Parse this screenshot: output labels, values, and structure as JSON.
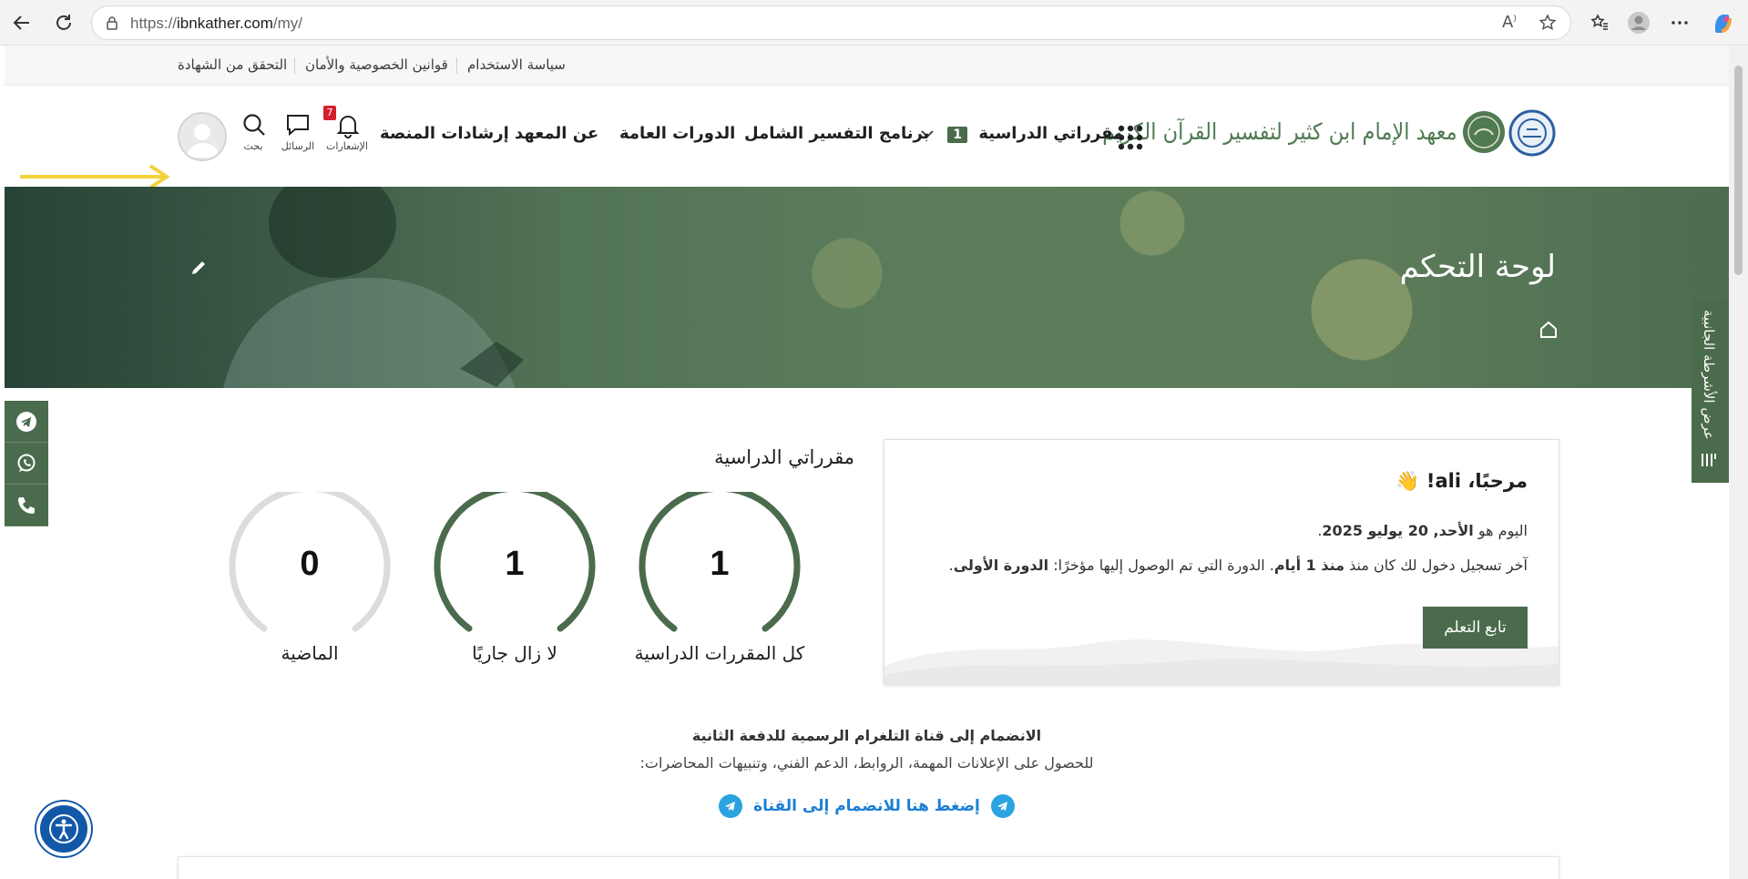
{
  "browser": {
    "url_prefix": "https://",
    "url_domain": "ibnkather.com",
    "url_path": "/my/",
    "read_aloud_label": "A",
    "profile_initial": ""
  },
  "topbar": {
    "links": [
      "سياسة الاستخدام",
      "قوانين الخصوصية والأمان",
      "التحقق من الشهادة"
    ]
  },
  "header": {
    "logo_text": "معهد الإمام ابن كثير لتفسير القرآن الكريم",
    "nav": {
      "my_courses": "مقرراتي الدراسية",
      "my_courses_count": "1",
      "tafsir_program": "برنامج التفسير الشامل",
      "general_courses": "الدورات العامة",
      "about": "عن المعهد",
      "guidance": "إرشادات المنصة"
    },
    "icons": {
      "notifications_label": "الإشعارات",
      "notifications_count": "7",
      "messages_label": "الرسائل",
      "search_label": "بحث"
    }
  },
  "hero": {
    "title": "لوحة التحكم"
  },
  "side_tab": {
    "label": "عرض الأشرطة الجانبية"
  },
  "welcome": {
    "greeting": "مرحبًا، ali! 👋",
    "today_prefix": "اليوم هو ",
    "today_date": "الأحد, 20 يوليو 2025",
    "today_suffix": ".",
    "last_login_prefix": "آخر تسجيل دخول لك كان منذ ",
    "last_login_value": "منذ 1 أيام",
    "last_course_prefix": ". الدورة التي تم الوصول إليها مؤخرًا: ",
    "last_course_value": "الدورة الأولى",
    "last_course_suffix": ".",
    "continue_button": "تابع التعلم"
  },
  "courses": {
    "title": "مقرراتي الدراسية",
    "gauges": [
      {
        "label": "كل المقررات الدراسية",
        "value": "1",
        "fill": 1
      },
      {
        "label": "لا زال جاريًا",
        "value": "1",
        "fill": 1
      },
      {
        "label": "الماضية",
        "value": "0",
        "fill": 0
      }
    ]
  },
  "telegram": {
    "title": "الانضمام إلى قناة التلغرام الرسمية للدفعة الثانية",
    "subtitle": "للحصول على الإعلانات المهمة، الروابط، الدعم الفني، وتنبيهات المحاضرات:",
    "link_text": "إضغط هنا للانضمام إلى القناة"
  },
  "colors": {
    "brand_green": "#4a6b4c",
    "gauge_track": "#dcdcdc",
    "link_blue": "#1e7fd6",
    "badge_red": "#d3202a",
    "annotation_yellow": "#f2d23a"
  }
}
